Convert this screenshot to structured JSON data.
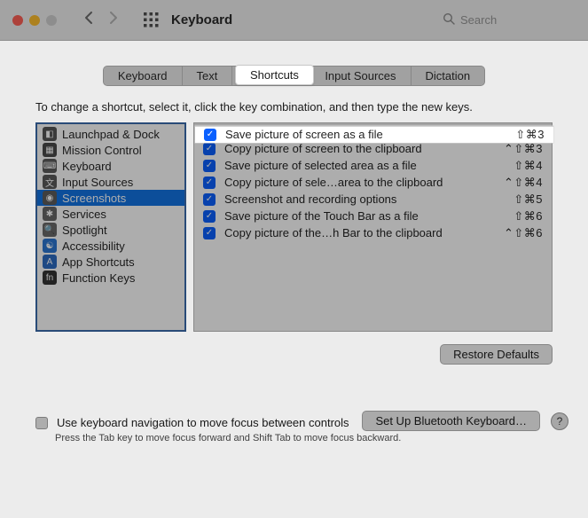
{
  "window": {
    "title": "Keyboard",
    "search_placeholder": "Search"
  },
  "tabs": [
    {
      "label": "Keyboard"
    },
    {
      "label": "Text"
    },
    {
      "label": "Shortcuts",
      "active": true
    },
    {
      "label": "Input Sources"
    },
    {
      "label": "Dictation"
    }
  ],
  "instruction": "To change a shortcut, select it, click the key combination, and then type the new keys.",
  "categories": [
    {
      "label": "Launchpad & Dock",
      "icon_bg": "#555555"
    },
    {
      "label": "Mission Control",
      "icon_bg": "#4a4a4a"
    },
    {
      "label": "Keyboard",
      "icon_bg": "#5b5b5b"
    },
    {
      "label": "Input Sources",
      "icon_bg": "#5a5a5a"
    },
    {
      "label": "Screenshots",
      "icon_bg": "#5c5c5c",
      "selected": true
    },
    {
      "label": "Services",
      "icon_bg": "#676767"
    },
    {
      "label": "Spotlight",
      "icon_bg": "#6a6a6a"
    },
    {
      "label": "Accessibility",
      "icon_bg": "#2a76d2"
    },
    {
      "label": "App Shortcuts",
      "icon_bg": "#2c6bc2"
    },
    {
      "label": "Function Keys",
      "icon_bg": "#333333"
    }
  ],
  "shortcuts": [
    {
      "checked": true,
      "label": "Save picture of screen as a file",
      "keys": "⇧⌘3",
      "highlight": true
    },
    {
      "checked": true,
      "label": "Copy picture of screen to the clipboard",
      "keys": "⌃⇧⌘3"
    },
    {
      "checked": true,
      "label": "Save picture of selected area as a file",
      "keys": "⇧⌘4"
    },
    {
      "checked": true,
      "label": "Copy picture of sele…area to the clipboard",
      "keys": "⌃⇧⌘4"
    },
    {
      "checked": true,
      "label": "Screenshot and recording options",
      "keys": "⇧⌘5"
    },
    {
      "checked": true,
      "label": "Save picture of the Touch Bar as a file",
      "keys": "⇧⌘6"
    },
    {
      "checked": true,
      "label": "Copy picture of the…h Bar to the clipboard",
      "keys": "⌃⇧⌘6"
    }
  ],
  "buttons": {
    "restore": "Restore Defaults",
    "bluetooth": "Set Up Bluetooth Keyboard…"
  },
  "keyboard_nav": {
    "checkbox_label": "Use keyboard navigation to move focus between controls",
    "hint": "Press the Tab key to move focus forward and Shift Tab to move focus backward."
  }
}
